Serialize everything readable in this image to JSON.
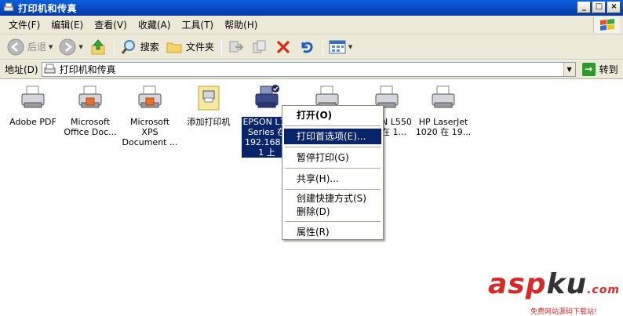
{
  "window": {
    "title": "打印机和传真"
  },
  "menu": [
    "文件(F)",
    "编辑(E)",
    "查看(V)",
    "收藏(A)",
    "工具(T)",
    "帮助(H)"
  ],
  "toolbar": {
    "back": "后退",
    "search": "搜索",
    "folders": "文件夹"
  },
  "address": {
    "label": "地址(D)",
    "value": "打印机和传真",
    "go": "转到"
  },
  "printers": [
    {
      "label": "Adobe PDF"
    },
    {
      "label": "Microsoft\nOffice Doc..."
    },
    {
      "label": "Microsoft XPS\nDocument ..."
    },
    {
      "label": "添加打印机"
    },
    {
      "label": "EPSON L18\nSeries 在\n192.168.1\n1 上"
    },
    {
      "label": "N L550\n在 1..."
    },
    {
      "label": "HP LaserJet\n1020 在 19..."
    }
  ],
  "context_menu": {
    "open": "打开(O)",
    "preferences": "打印首选项(E)...",
    "pause": "暂停打印(G)",
    "share": "共享(H)...",
    "shortcut": "创建快捷方式(S)",
    "delete": "删除(D)",
    "properties": "属性(R)"
  },
  "watermark": {
    "brand_a": "asp",
    "brand_b": "ku",
    "brand_c": ".com",
    "tagline": "免费网站源码下载站!"
  },
  "colors": {
    "titlebar": "#0847c0",
    "selection": "#0a246a",
    "toolbar_bg": "#ece9d8",
    "watermark": "#d42a2a"
  }
}
